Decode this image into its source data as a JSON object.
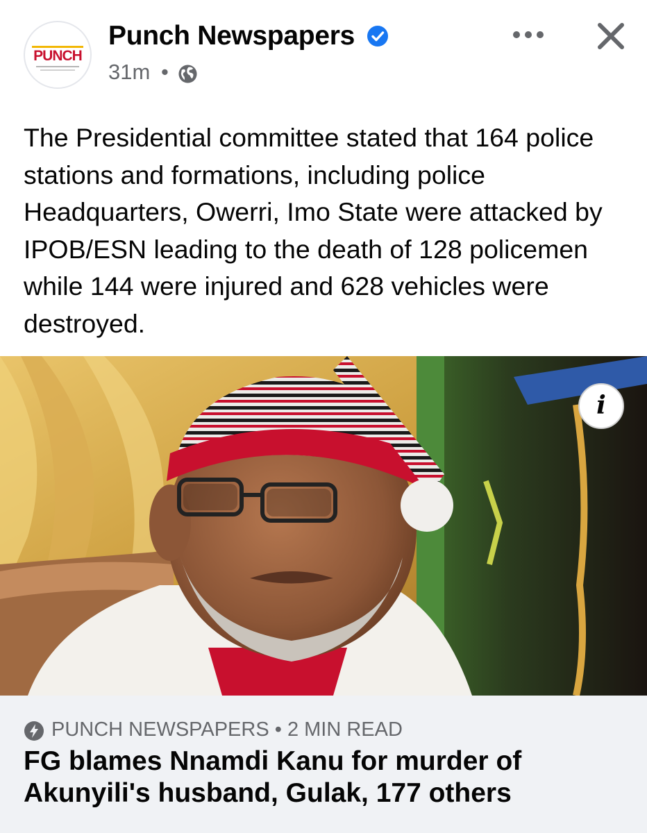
{
  "post": {
    "page_name": "Punch Newspapers",
    "avatar_logo": "PUNCH",
    "time": "31m",
    "separator": "•",
    "verified_icon": "verified-check-icon",
    "audience_icon": "globe-icon",
    "text": "The Presidential committee stated that 164 police stations and formations, including police Headquarters, Owerri, Imo State were attacked by IPOB/ESN leading to the death of 128 policemen while 144 were injured and 628 vehicles were destroyed.",
    "more_icon": "more-options-icon",
    "close_icon": "close-icon"
  },
  "link_preview": {
    "info_label": "i",
    "source_line": "PUNCH NEWSPAPERS • 2 MIN READ",
    "headline": "FG blames Nnamdi Kanu for murder of Akunyili's husband, Gulak, 177 others",
    "icon": "instant-article-bolt-icon"
  },
  "colors": {
    "brand_blue": "#1877f2",
    "secondary_text": "#65676b",
    "card_bg": "#f0f2f5",
    "punch_red": "#c8102e"
  }
}
